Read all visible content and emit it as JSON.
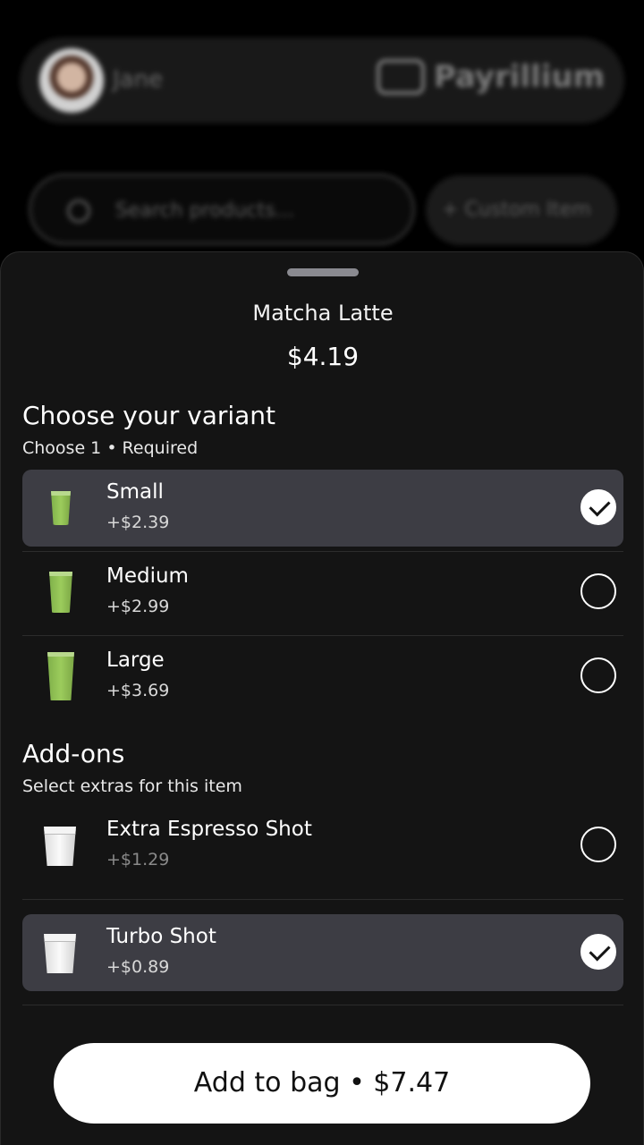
{
  "background": {
    "user_name": "Jane",
    "brand_name": "Payrillium",
    "search_placeholder": "Search products...",
    "custom_item_label": "+ Custom Item"
  },
  "product": {
    "name": "Matcha Latte",
    "price": "$4.19"
  },
  "variants": {
    "title": "Choose your variant",
    "subtitle": "Choose 1 • Required",
    "items": [
      {
        "label": "Small",
        "price": "+$2.39",
        "selected": true
      },
      {
        "label": "Medium",
        "price": "+$2.99",
        "selected": false
      },
      {
        "label": "Large",
        "price": "+$3.69",
        "selected": false
      }
    ]
  },
  "addons": {
    "title": "Add-ons",
    "subtitle": "Select extras for this item",
    "items": [
      {
        "label": "Extra Espresso Shot",
        "price": "+$1.29",
        "selected": false
      },
      {
        "label": "Turbo Shot",
        "price": "+$0.89",
        "selected": true
      }
    ]
  },
  "cta": {
    "label": "Add to bag • $7.47"
  },
  "colors": {
    "sheet": "#141414",
    "selected_row": "#3d3d44",
    "cta_bg": "#ffffff",
    "matcha": "#9ccc5c"
  }
}
